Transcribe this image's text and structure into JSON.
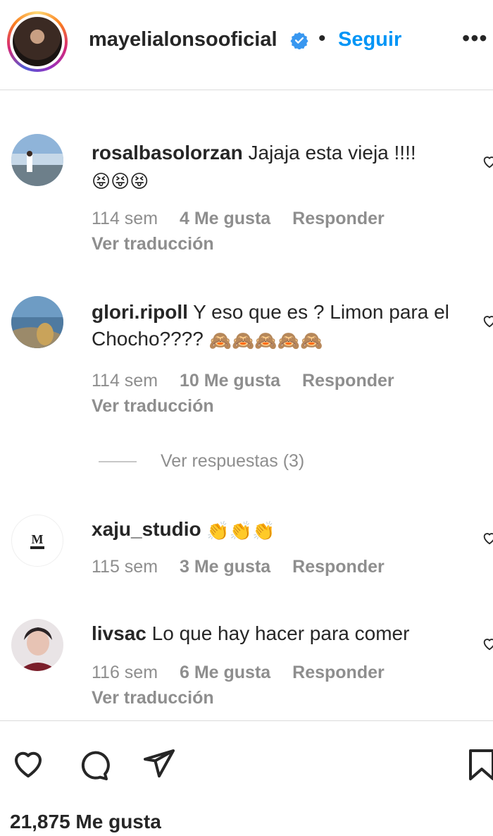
{
  "header": {
    "username": "mayelialonsooficial",
    "dot": "•",
    "follow_label": "Seguir",
    "more": "•••"
  },
  "comments": [
    {
      "user": "rosalbasolorzan",
      "text": "Jajaja esta vieja !!!!",
      "emoji": "😝😝😝",
      "time": "114 sem",
      "likes": "4 Me gusta",
      "reply": "Responder",
      "translate": "Ver traducción"
    },
    {
      "user": "glori.ripoll",
      "text": "Y eso que es ? Limon para el Chocho????",
      "emoji": "🙈🙈🙈🙈🙈",
      "time": "114 sem",
      "likes": "10 Me gusta",
      "reply": "Responder",
      "translate": "Ver traducción"
    },
    {
      "user": "xaju_studio",
      "text": "",
      "emoji": "👏👏👏",
      "time": "115 sem",
      "likes": "3 Me gusta",
      "reply": "Responder",
      "translate": ""
    },
    {
      "user": "livsac",
      "text": "Lo que hay hacer para comer",
      "emoji": "",
      "time": "116 sem",
      "likes": "6 Me gusta",
      "reply": "Responder",
      "translate": "Ver traducción"
    }
  ],
  "view_replies": "Ver respuestas (3)",
  "likes_total": "21,875 Me gusta",
  "icons": [
    "verified-badge-icon",
    "heart-icon",
    "comment-icon",
    "share-icon",
    "bookmark-icon"
  ],
  "colors": {
    "link": "#0095f6",
    "muted": "#8e8e8e",
    "text": "#262626",
    "border": "#dbdbdb"
  }
}
